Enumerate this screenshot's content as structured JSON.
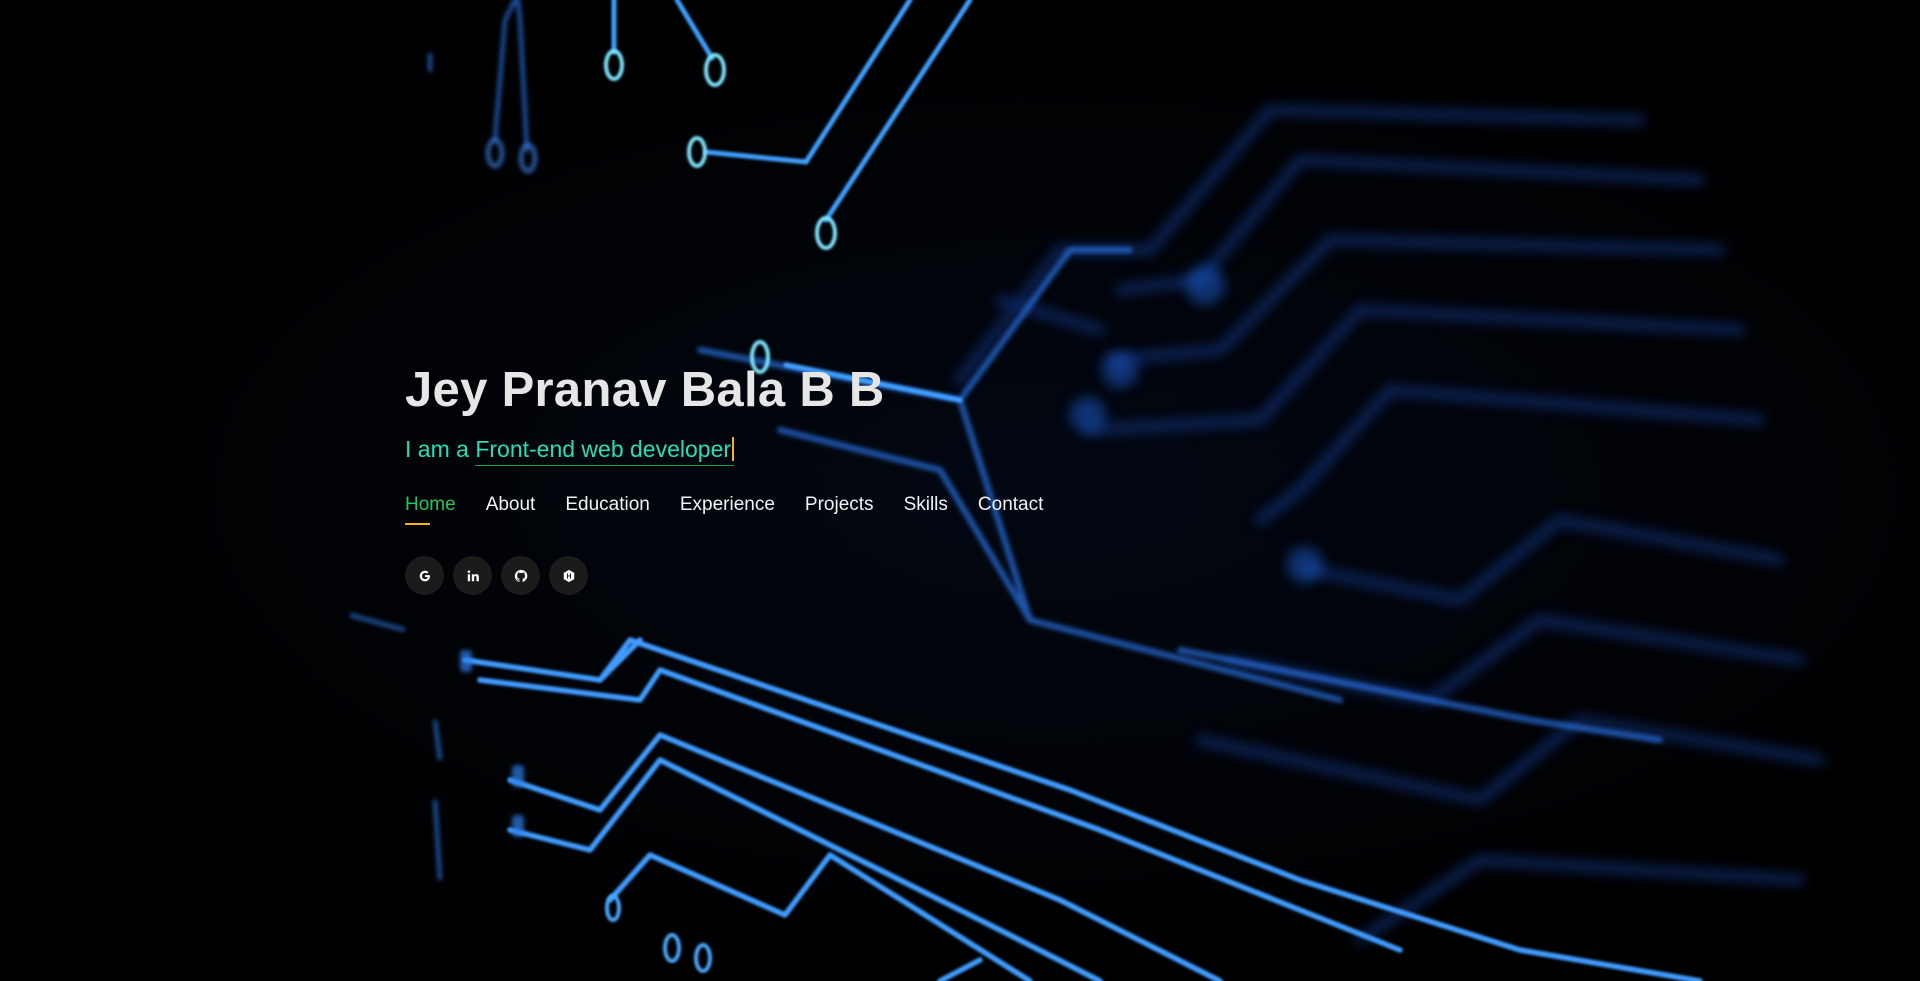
{
  "hero": {
    "name": "Jey Pranav Bala B B",
    "tagline_prefix": "I am a ",
    "tagline_typed": "Front-end web developer"
  },
  "nav": {
    "items": [
      {
        "label": "Home",
        "active": true
      },
      {
        "label": "About"
      },
      {
        "label": "Education"
      },
      {
        "label": "Experience"
      },
      {
        "label": "Projects"
      },
      {
        "label": "Skills"
      },
      {
        "label": "Contact"
      }
    ]
  },
  "social": {
    "icons": [
      "google-icon",
      "linkedin-icon",
      "github-icon",
      "hackerrank-icon"
    ]
  },
  "colors": {
    "background": "#000000",
    "name": "#e6e6e6",
    "tagline": "#25e0b6",
    "nav_active": "#22c55e",
    "nav_underline": "#f5b21a",
    "circuit": "#2f8cff"
  }
}
